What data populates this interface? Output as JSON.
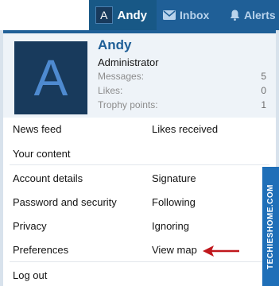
{
  "topnav": {
    "avatar_letter": "A",
    "user_label": "Andy",
    "inbox_label": "Inbox",
    "alerts_label": "Alerts"
  },
  "profile": {
    "avatar_letter": "A",
    "name": "Andy",
    "role": "Administrator",
    "stats": [
      {
        "label": "Messages:",
        "value": "5"
      },
      {
        "label": "Likes:",
        "value": "0"
      },
      {
        "label": "Trophy points:",
        "value": "1"
      }
    ]
  },
  "links": {
    "news_feed": "News feed",
    "likes_received": "Likes received",
    "your_content": "Your content",
    "account_details": "Account details",
    "signature": "Signature",
    "password_security": "Password and security",
    "following": "Following",
    "privacy": "Privacy",
    "ignoring": "Ignoring",
    "preferences": "Preferences",
    "view_map": "View map",
    "log_out": "Log out"
  },
  "watermark": "TECHIESHOME.COM",
  "colors": {
    "brand_blue": "#1f5f97",
    "profile_bg": "#eef3f8",
    "arrow_red": "#c0171c"
  }
}
